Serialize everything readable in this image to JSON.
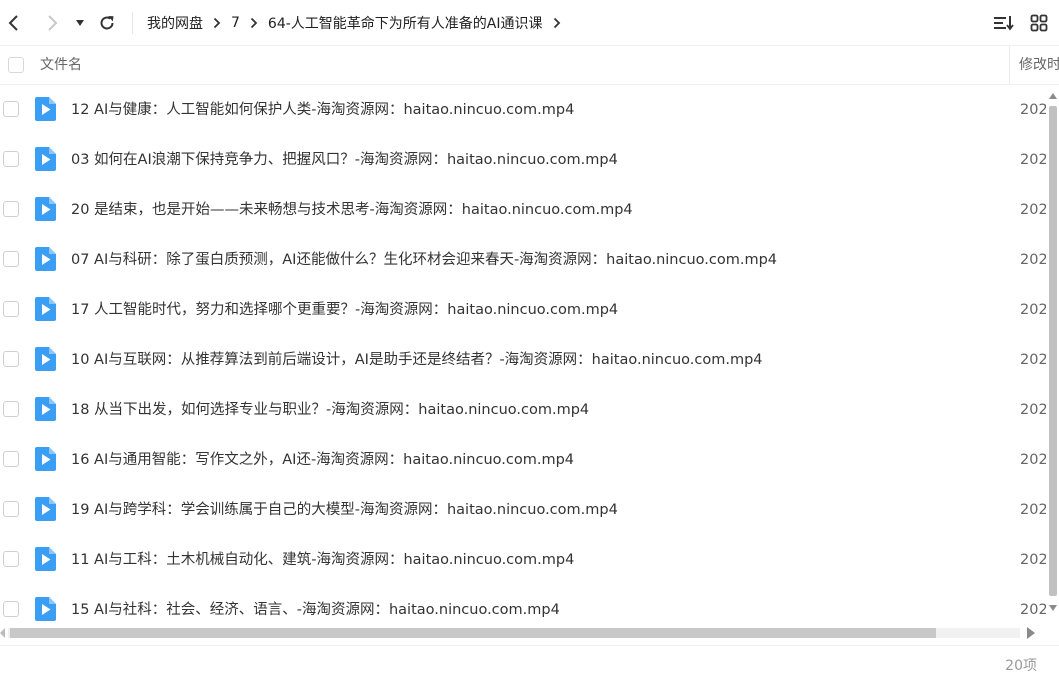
{
  "toolbar": {
    "back_icon": "chevron-left-icon",
    "forward_icon": "chevron-right-icon",
    "history_dropdown_icon": "caret-down-icon",
    "refresh_icon": "refresh-icon",
    "sort_icon": "sort-icon",
    "view_icon": "grid-view-icon"
  },
  "breadcrumb": [
    "我的网盘",
    "7",
    "64-人工智能革命下为所有人准备的AI通识课"
  ],
  "columns": {
    "name": "文件名",
    "modified": "修改时间"
  },
  "files": [
    {
      "name": "12 AI与健康：人工智能如何保护人类-海淘资源网：haitao.nincuo.com.mp4",
      "date": "202"
    },
    {
      "name": "03 如何在AI浪潮下保持竞争力、把握风口？-海淘资源网：haitao.nincuo.com.mp4",
      "date": "202"
    },
    {
      "name": "20 是结束，也是开始——未来畅想与技术思考-海淘资源网：haitao.nincuo.com.mp4",
      "date": "202"
    },
    {
      "name": "07 AI与科研：除了蛋白质预测，AI还能做什么？生化环材会迎来春天-海淘资源网：haitao.nincuo.com.mp4",
      "date": "202"
    },
    {
      "name": "17 人工智能时代，努力和选择哪个更重要？-海淘资源网：haitao.nincuo.com.mp4",
      "date": "202"
    },
    {
      "name": "10 AI与互联网：从推荐算法到前后端设计，AI是助手还是终结者？-海淘资源网：haitao.nincuo.com.mp4",
      "date": "202"
    },
    {
      "name": "18 从当下出发，如何选择专业与职业？-海淘资源网：haitao.nincuo.com.mp4",
      "date": "202"
    },
    {
      "name": "16 AI与通用智能：写作文之外，AI还-海淘资源网：haitao.nincuo.com.mp4",
      "date": "202"
    },
    {
      "name": "19 AI与跨学科：学会训练属于自己的大模型-海淘资源网：haitao.nincuo.com.mp4",
      "date": "202"
    },
    {
      "name": "11 AI与工科：土木机械自动化、建筑-海淘资源网：haitao.nincuo.com.mp4",
      "date": "202"
    },
    {
      "name": "15 AI与社科：社会、经济、语言、-海淘资源网：haitao.nincuo.com.mp4",
      "date": "202"
    }
  ],
  "file_icon": "video-file-icon",
  "footer": {
    "count": "20项"
  },
  "colors": {
    "video_icon": "#3a9ef5",
    "text": "#333333",
    "muted": "#999999"
  }
}
